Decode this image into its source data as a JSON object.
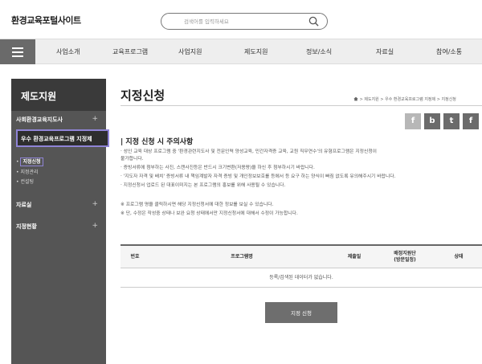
{
  "header": {
    "logo": "환경교육포털사이트",
    "search_placeholder": "검색어를 입력하세요"
  },
  "nav": {
    "items": [
      "사업소개",
      "교육프로그램",
      "사업지원",
      "제도지원",
      "정보/소식",
      "자료실",
      "참여/소통"
    ]
  },
  "sidebar": {
    "title": "제도지원",
    "item_1": "사회환경교육지도사",
    "active_item": "우수 환경교육프로그램 지정제",
    "sub_items": [
      "지정신청",
      "지정관리",
      "컨설팅"
    ],
    "item_2": "자료실",
    "item_3": "지정현황",
    "plus": "+"
  },
  "main": {
    "title": "지정신청",
    "breadcrumb": "> 제도지원 > 우수 환경교육프로그램 지정제 > 지정신청",
    "share": [
      "f",
      "b",
      "t",
      "f"
    ],
    "section_heading": "| 지정 신청 시 주의사항",
    "notes": [
      "· 성인 교육 대상 프로그램 중 '환경관련지도사 및 전문인력 양성교육, 민간자격증 교육, 교원 직무연수'의 유형프로그램은 지정신청이",
      "  불가합니다.",
      "· 증빙서류에 첨부하는 사진, 스캔사진등은 반드시 크기변환(저용량)을 하신 후 첨부하시기 바랍니다.",
      "· '지도자 자격 및 배치' 증빙서류 내 책임계발자 자격 증빙 및 개인정보보호를 등에서 등 요구 하는 양식이 빠짐 없도록 유의해주시기 바랍니다.",
      "· 지정신청서 업로드 된 대표이미지는 본 프로그램의 홍보를 위해 사용될 수 있습니다."
    ],
    "notes_2": [
      "※ 프로그램 명을 클릭하시면 해당 지정신청서에 대한 정보를 보실 수 있습니다.",
      "※ 단, 수정은 작성중 상태나 보완 요청 상태에서만 지정신청서에 대해서 수정이 가능합니다."
    ],
    "table": {
      "headers": [
        "번호",
        "프로그램명",
        "제출일",
        "배정지원단\n(방문일정)",
        "상태"
      ],
      "empty_message": "등록/검색된 데이터가 없습니다."
    },
    "apply_button": "지정 신청"
  },
  "colors": {
    "sidebar_bg": "#555555",
    "sidebar_title_bg": "#3a3a3a",
    "highlight": "#8f84d6",
    "button": "#6e6e6e"
  }
}
